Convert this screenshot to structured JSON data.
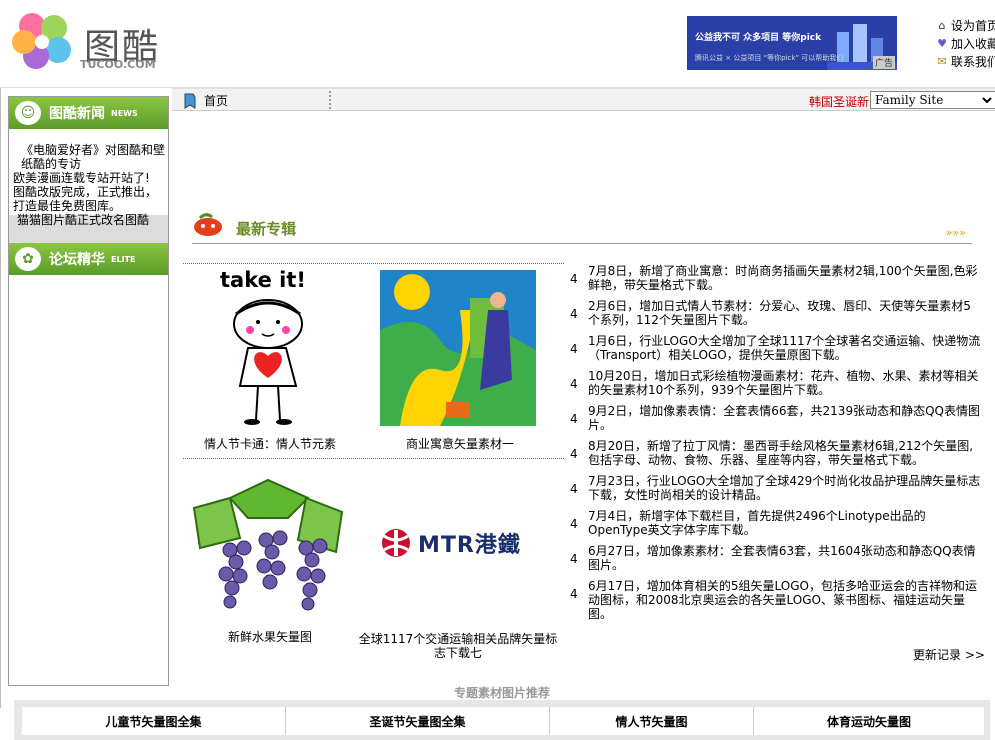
{
  "site": {
    "logo_text": "图酷",
    "logo_sub": "TUCOO.COM"
  },
  "ad": {
    "headline": "公益我不可 众多项目 等你pick",
    "subline": "腾讯公益 × 公益项目 “等你pick” 可以帮助我们",
    "badge": "广告"
  },
  "toplinks": [
    {
      "icon": "home-icon",
      "label": "设为首页"
    },
    {
      "icon": "heart-icon",
      "label": "加入收藏"
    },
    {
      "icon": "mail-icon",
      "label": "联系我们"
    }
  ],
  "nav": {
    "home": "首页",
    "korean_link": "韩国圣诞新",
    "family_select": "Family Site"
  },
  "sidebar": {
    "news_title": "图酷新闻",
    "news_badge": "NEWS",
    "news_items": [
      "《电脑爱好者》对图酷和壁纸酷的专访",
      "欧美漫画连载专站开站了!",
      "图酷改版完成，正式推出，打造最佳免费图库。",
      "猫猫图片酷正式改名图酷"
    ],
    "forum_title": "论坛精华",
    "forum_badge": "ELITE"
  },
  "main": {
    "section_title": "最新专辑",
    "arrows": "»»»",
    "items": [
      {
        "caption": "情人节卡通：情人节元素",
        "image_label": "take it!"
      },
      {
        "caption": "商业寓意矢量素材一"
      },
      {
        "caption": "新鲜水果矢量图"
      },
      {
        "caption": "全球1117个交通运输相关品牌矢量标志下载七",
        "image_label": "MTR港鐵"
      }
    ]
  },
  "updates": [
    {
      "num": "4",
      "text": "7月8日，新增了商业寓意：时尚商务插画矢量素材2辑,100个矢量图,色彩鲜艳，带矢量格式下载。"
    },
    {
      "num": "4",
      "text": "2月6日，增加日式情人节素材：分爱心、玫瑰、唇印、天使等矢量素材5个系列，112个矢量图片下载。"
    },
    {
      "num": "4",
      "text": "1月6日，行业LOGO大全增加了全球1117个全球著名交通运输、快递物流（Transport）相关LOGO，提供矢量原图下载。"
    },
    {
      "num": "4",
      "text": "10月20日，增加日式彩绘植物漫画素材：花卉、植物、水果、素材等相关的矢量素材10个系列，939个矢量图片下载。"
    },
    {
      "num": "4",
      "text": "9月2日，增加像素表情：全套表情66套，共2139张动态和静态QQ表情图片。"
    },
    {
      "num": "4",
      "text": "8月20日，新增了拉丁风情：墨西哥手绘风格矢量素材6辑,212个矢量图,包括字母、动物、食物、乐器、星座等内容，带矢量格式下载。"
    },
    {
      "num": "4",
      "text": "7月23日，行业LOGO大全增加了全球429个时尚化妆品护理品牌矢量标志下载，女性时尚相关的设计精品。"
    },
    {
      "num": "4",
      "text": "7月4日，新增字体下载栏目，首先提供2496个Linotype出品的OpenType英文字体字库下载。"
    },
    {
      "num": "4",
      "text": "6月27日，增加像素素材：全套表情63套，共1604张动态和静态QQ表情图片。"
    },
    {
      "num": "4",
      "text": "6月17日，增加体育相关的5组矢量LOGO，包括多哈亚运会的吉祥物和运动图标，和2008北京奥运会的各矢量LOGO、篆书图标、福娃运动矢量图。"
    }
  ],
  "more_label": "更新记录 >>",
  "recommend": {
    "title": "专题素材图片推荐",
    "cells": [
      "儿童节矢量图全集",
      "圣诞节矢量图全集",
      "情人节矢量图",
      "体育运动矢量图"
    ]
  },
  "colors": {
    "accent_green": "#6b8e23",
    "nav_red": "#cc0000",
    "ad_blue": "#2a3fa8"
  }
}
